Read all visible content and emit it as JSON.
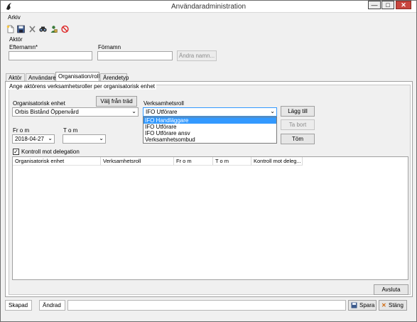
{
  "window": {
    "title": "Användaradministration"
  },
  "menubar": {
    "items": [
      "Arkiv"
    ]
  },
  "toolbar": {
    "icons": [
      "new-icon",
      "save-icon",
      "delete-icon",
      "search-icon",
      "users-icon",
      "block-icon"
    ]
  },
  "aktor": {
    "section_label": "Aktör",
    "efternamn_label": "Efternamn*",
    "efternamn_value": "",
    "fornamn_label": "Förnamn",
    "fornamn_value": "",
    "andra_namn_button": "Ändra namn..."
  },
  "tabs": [
    {
      "label": "Aktör",
      "active": false
    },
    {
      "label": "Användare",
      "active": false
    },
    {
      "label": "Organisation/roll",
      "active": true
    },
    {
      "label": "Ärendetyp",
      "active": false
    }
  ],
  "org_panel": {
    "group_title": "Ange aktörens verksamhetsroller per organisatorisk enhet",
    "org_enhet_label": "Organisatorisk enhet",
    "valj_fran_trad_button": "Välj från träd",
    "org_enhet_value": "Orbis  Bistånd Öppenvård",
    "verksamhetsroll_label": "Verksamhetsroll",
    "verksamhetsroll_value": "IFO Utförare",
    "verksamhetsroll_options": [
      "IFO Handläggare",
      "IFO Utförare",
      "IFO Utförare ansv",
      "Verksamhetsombud"
    ],
    "verksamhetsroll_highlighted": "IFO Handläggare",
    "lagg_till_button": "Lägg till",
    "ta_bort_button": "Ta bort",
    "tom_button": "Töm",
    "from_label": "Fr o m",
    "from_value": "2018-04-27",
    "tom_label": "T o m",
    "tom_value": "",
    "kontroll_checkbox_label": "Kontroll mot delegation",
    "kontroll_checked": true,
    "grid_columns": [
      "Organisatorisk enhet",
      "Verksamhetsroll",
      "Fr o m",
      "T o m",
      "Kontroll mot deleg..."
    ],
    "avsluta_button": "Avsluta"
  },
  "statusbar": {
    "skapad_label": "Skapad",
    "andrad_label": "Ändrad",
    "spara_button": "Spara",
    "stang_button": "Stäng"
  },
  "colors": {
    "highlight": "#3399ff",
    "close_button": "#c7463e",
    "background": "#f0f0f0"
  }
}
